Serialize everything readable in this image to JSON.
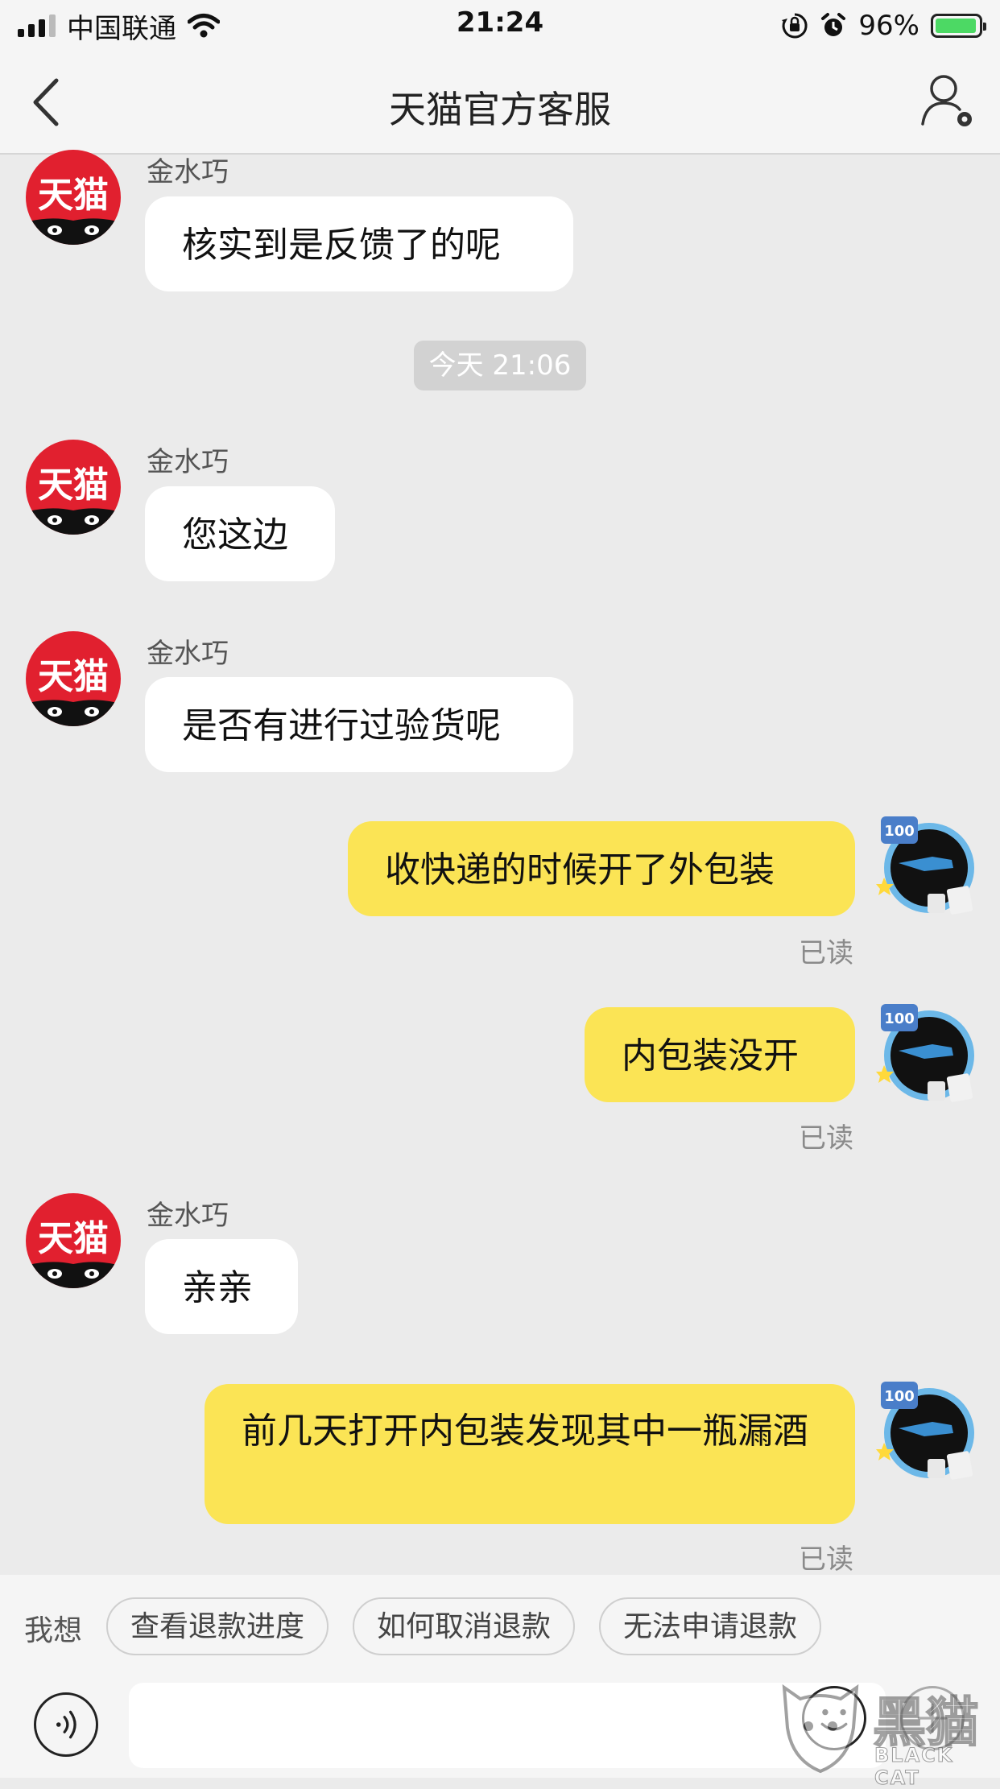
{
  "status_bar": {
    "carrier": "中国联通",
    "time": "21:24",
    "battery": "96%",
    "battery_level": 0.96,
    "icons": [
      "signal-icon",
      "wifi-icon",
      "orientation-lock-icon",
      "alarm-icon",
      "battery-icon"
    ]
  },
  "nav": {
    "title": "天猫官方客服",
    "back_icon": "chevron-left-icon",
    "profile_icon": "user-settings-icon"
  },
  "colors": {
    "incoming_bubble": "#ffffff",
    "outgoing_bubble": "#fbe455",
    "tmall_red": "#e1202f",
    "background": "#ebebeb"
  },
  "chat": {
    "agent_avatar_text": "天猫",
    "timestamp": "今天 21:06",
    "messages": [
      {
        "from": "agent",
        "sender": "金水巧",
        "text": "核实到是反馈了的呢"
      },
      {
        "from": "agent",
        "sender": "金水巧",
        "text": "您这边"
      },
      {
        "from": "agent",
        "sender": "金水巧",
        "text": "是否有进行过验货呢"
      },
      {
        "from": "me",
        "text": "收快递的时候开了外包装",
        "status": "已读"
      },
      {
        "from": "me",
        "text": "内包装没开",
        "status": "已读"
      },
      {
        "from": "agent",
        "sender": "金水巧",
        "text": "亲亲"
      },
      {
        "from": "me",
        "text": "前几天打开内包装发现其中一瓶漏酒",
        "status": "已读"
      }
    ],
    "user_avatar_badge": "100"
  },
  "quick_replies": {
    "label": "我想",
    "options": [
      "查看退款进度",
      "如何取消退款",
      "无法申请退款"
    ]
  },
  "input": {
    "value": "",
    "placeholder": "",
    "icons": [
      "voice-icon",
      "emoji-icon",
      "plus-icon"
    ]
  },
  "watermark": {
    "text": "黑猫",
    "sub": "BLACK CAT"
  }
}
